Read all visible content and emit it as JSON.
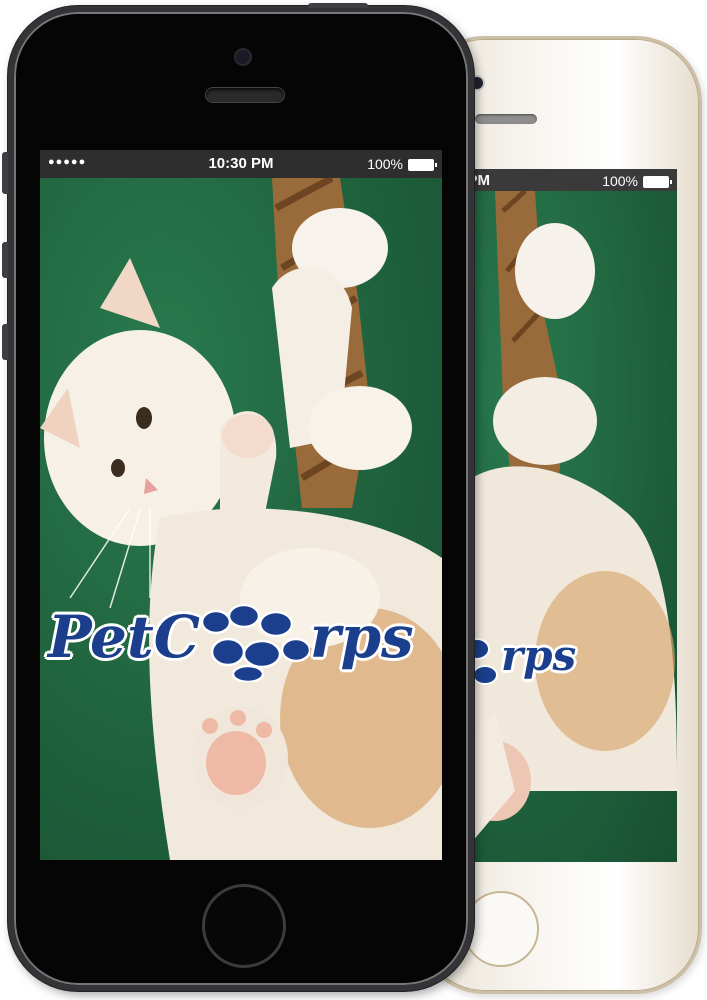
{
  "status_bar": {
    "signal": "●●●●●",
    "time": "10:30 PM",
    "battery_percent": "100%",
    "battery_level": 1.0
  },
  "back_status_bar": {
    "time_fragment": "0 PM",
    "battery_percent": "100%"
  },
  "logo": {
    "left_text": "PetC",
    "right_text": "rps",
    "back_right_text": "rps",
    "icon": "paw-prints-icon"
  },
  "colors": {
    "logo_blue": "#1b3f8c",
    "wallpaper_green": "#1f623d",
    "status_bar": "#2e2e2e"
  }
}
